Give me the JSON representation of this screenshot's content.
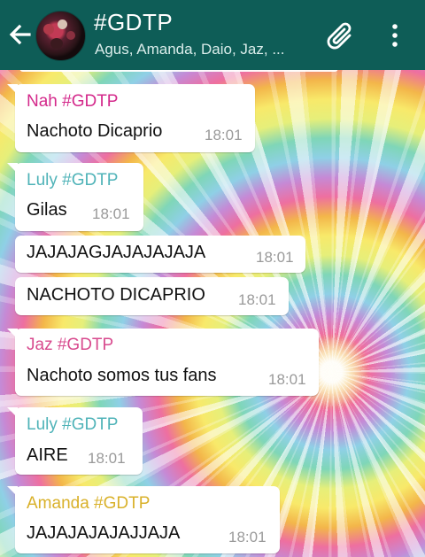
{
  "header": {
    "title": "#GDTP",
    "subtitle": "Agus, Amanda, Daio, Jaz, ..."
  },
  "colors": {
    "header_bg": "#0e5d57",
    "sender_nah": "#d4298b",
    "sender_luly": "#4fb3b8",
    "sender_jaz": "#d84a8e",
    "sender_amanda": "#d9b12a"
  },
  "icons": [
    "arrow-left-icon",
    "paperclip-icon",
    "more-vertical-icon"
  ],
  "messages": [
    {
      "sender": "Nah #GDTP",
      "text": "Nachoto Dicaprio",
      "time": "18:01"
    },
    {
      "sender": "Luly #GDTP",
      "text": "Gilas",
      "time": "18:01"
    },
    {
      "text": "JAJAJAGJAJAJAJAJA",
      "time": "18:01"
    },
    {
      "text": "NACHOTO DICAPRIO",
      "time": "18:01"
    },
    {
      "sender": "Jaz #GDTP",
      "text": "Nachoto somos tus fans",
      "time": "18:01"
    },
    {
      "sender": "Luly #GDTP",
      "text": "AIRE",
      "time": "18:01"
    },
    {
      "sender": "Amanda #GDTP",
      "text": "JAJAJAJAJAJJAJA",
      "time": "18:01"
    }
  ]
}
